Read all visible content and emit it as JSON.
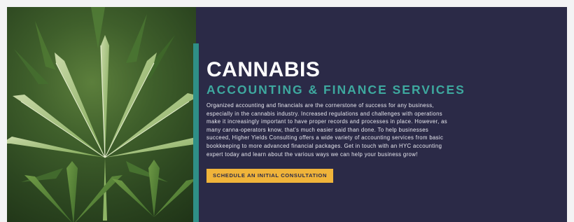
{
  "hero": {
    "title": "CANNABIS",
    "subtitle": "ACCOUNTING & FINANCE SERVICES",
    "body": "Organized accounting and financials are the cornerstone of success for any business,\nespecially in the cannabis industry. Increased regulations and challenges with operations\nmake it increasingly important to have proper records and processes in place. However, as\nmany canna-operators know, that's much easier said than done. To help businesses\nsucceed, Higher Yields Consulting offers a wide variety of accounting services from basic\nbookkeeping to more advanced financial packages. Get in touch with an HYC accounting\nexpert today and learn about the various ways we can help your business grow!",
    "cta_label": "SCHEDULE AN INITIAL CONSULTATION"
  },
  "colors": {
    "panel_background": "#2b2a47",
    "accent_teal": "#3ea99f",
    "accent_bar": "#2f8f86",
    "button_yellow": "#f0b43a",
    "page_background": "#f3f3f4"
  },
  "icons": {
    "photo": "cannabis-leaf-photo"
  }
}
